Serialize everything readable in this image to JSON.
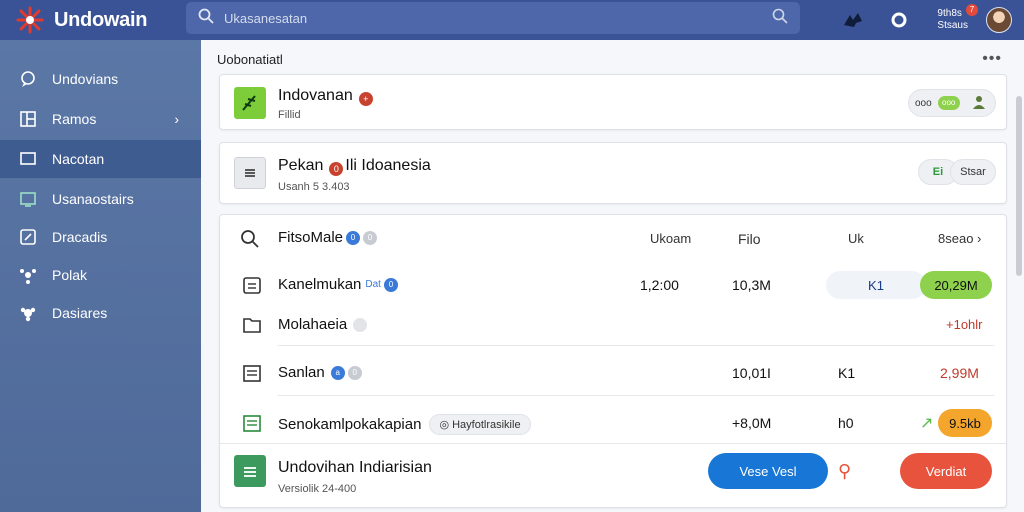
{
  "app": {
    "title": "Undowain",
    "search_placeholder": "Ukasanesatan",
    "user_line1": "9th8s",
    "user_line2": "Stsaus",
    "notif_count": "7"
  },
  "sidebar": {
    "items": [
      {
        "label": "Undovians",
        "icon": "chat-icon"
      },
      {
        "label": "Ramos",
        "icon": "grid-icon"
      },
      {
        "label": "Nacotan",
        "icon": "monitor-icon"
      },
      {
        "label": "Usanaostairs",
        "icon": "screen-icon"
      },
      {
        "label": "Dracadis",
        "icon": "edit-icon"
      },
      {
        "label": "Polak",
        "icon": "puzzle-icon"
      },
      {
        "label": "Dasiares",
        "icon": "settings-icon"
      }
    ]
  },
  "main": {
    "header": "Uobonatiatl",
    "card1": {
      "title": "Indovanan",
      "sub": "Fillid",
      "pill_left": "ooo",
      "pill_mid": "ooo"
    },
    "card2": {
      "title": "Pekan",
      "title_rest": "Ili Idoanesia",
      "sub": "Usanh 5 3.403",
      "btn1": "Ei",
      "btn2": "Stsar"
    },
    "table": {
      "header": {
        "name": "FitsoMale",
        "col1": "Ukoam",
        "col2": "Filo",
        "col3": "Uk",
        "col4": "8seao"
      },
      "rows": [
        {
          "name": "Kanelmukan",
          "tag": "Dat",
          "c1": "1,2:00",
          "c2": "10,3M",
          "c3": "K1",
          "c4": "20,29M"
        },
        {
          "name": "Molahaeia",
          "c4": "+1ohlr"
        },
        {
          "name": "Sanlan",
          "tag": "a",
          "c2": "10,01I",
          "c3": "K1",
          "c4": "2,99M"
        },
        {
          "name": "Senokamlpokakapian",
          "chip": "Hayfotlrasikile",
          "c2": "+8,0M",
          "c3": "h0",
          "c4": "9.5kb"
        }
      ]
    },
    "footer": {
      "title": "Undovihan Indiarisian",
      "sub": "Versiolik 24-400",
      "btn_blue": "Vese Vesl",
      "btn_red": "Verdiat"
    }
  },
  "colors": {
    "topbar": "#3a5296",
    "sidebar": "#5b77a6",
    "accent_blue": "#1877d6",
    "accent_red": "#e8533d",
    "accent_green": "#8ed14d"
  }
}
